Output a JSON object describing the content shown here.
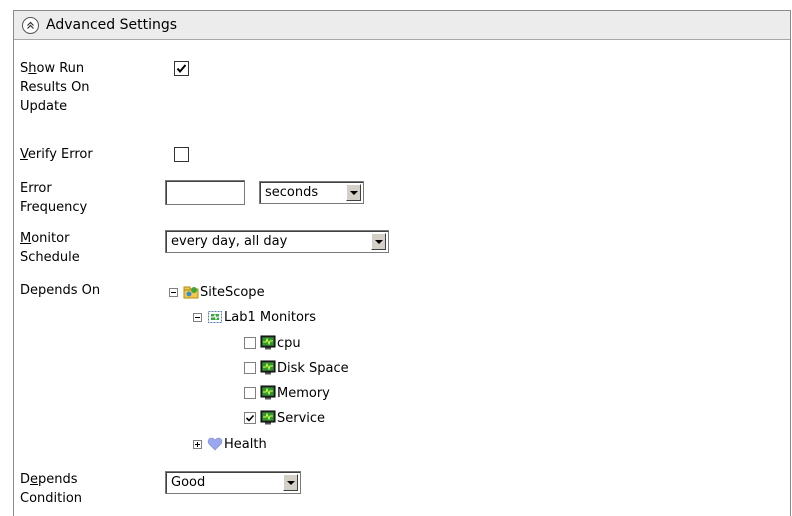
{
  "section": {
    "title": "Advanced Settings"
  },
  "fields": {
    "show_run_results": {
      "label_prefix": "S",
      "label_mnemonic": "h",
      "label_rest": "ow Run",
      "label_line2": "Results On",
      "label_line3": "Update",
      "checked": true
    },
    "verify_error": {
      "label_mnemonic": "V",
      "label_rest": "erify Error",
      "checked": false
    },
    "error_frequency": {
      "label_line1": "Error",
      "label_line2": "Frequency",
      "value": "",
      "unit": "seconds"
    },
    "monitor_schedule": {
      "label_mnemonic": "M",
      "label_rest": "onitor",
      "label_line2": "Schedule",
      "value": "every day, all day"
    },
    "depends_on": {
      "label": "Depends On"
    },
    "depends_condition": {
      "label_prefix": "D",
      "label_mnemonic": "e",
      "label_rest": "pends",
      "label_line2": "Condition",
      "value": "Good"
    }
  },
  "tree": {
    "root": "SiteScope",
    "group": "Lab1 Monitors",
    "monitors": [
      {
        "label": "cpu",
        "checked": false
      },
      {
        "label": "Disk Space",
        "checked": false
      },
      {
        "label": "Memory",
        "checked": false
      },
      {
        "label": "Service",
        "checked": true
      }
    ],
    "health": "Health"
  }
}
